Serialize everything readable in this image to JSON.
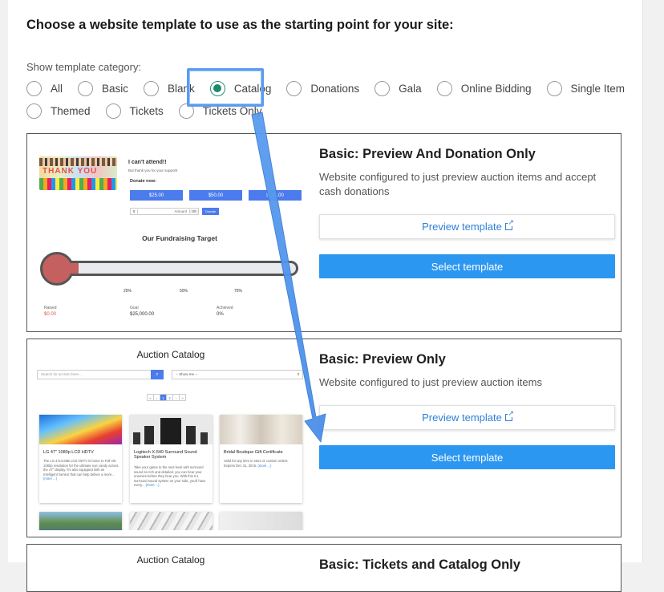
{
  "heading": "Choose a website template to use as the starting point for your site:",
  "category_label": "Show template category:",
  "categories_row1": [
    {
      "label": "All",
      "checked": false
    },
    {
      "label": "Basic",
      "checked": false
    },
    {
      "label": "Blank",
      "checked": false
    },
    {
      "label": "Catalog",
      "checked": true
    },
    {
      "label": "Donations",
      "checked": false
    },
    {
      "label": "Gala",
      "checked": false
    },
    {
      "label": "Online Bidding",
      "checked": false
    },
    {
      "label": "Single Item",
      "checked": false
    }
  ],
  "categories_row2": [
    {
      "label": "Themed",
      "checked": false
    },
    {
      "label": "Tickets",
      "checked": false
    },
    {
      "label": "Tickets Only",
      "checked": false
    }
  ],
  "colors": {
    "accent": "#2c97f0",
    "selected_radio": "#1c8a6d",
    "highlight": "#5a9bf0"
  },
  "cards": [
    {
      "title": "Basic: Preview And Donation Only",
      "description": "Website configured to just preview auction items and accept cash donations",
      "preview_label": "Preview template",
      "select_label": "Select template",
      "thumbnail": {
        "banner": "THANK YOU",
        "cant_attend": "I can't attend!!",
        "thanks": "But thank you for your support!",
        "donate_now": "Donate now:",
        "amounts": [
          "$25.00",
          "$50.00",
          "$100.00"
        ],
        "amount_prefix": "$",
        "amount_placeholder": "Amount",
        "amount_suffix": "00",
        "donate_button": "Donate",
        "target_title": "Our Fundraising Target",
        "ticks": [
          "25%",
          "50%",
          "75%"
        ],
        "stats": [
          {
            "label": "Raised",
            "value": "$0.00"
          },
          {
            "label": "Goal",
            "value": "$25,000.00"
          },
          {
            "label": "Achieved",
            "value": "0%"
          }
        ]
      }
    },
    {
      "title": "Basic: Preview Only",
      "description": "Website configured to just preview auction items",
      "preview_label": "Preview template",
      "select_label": "Select template",
      "thumbnail": {
        "title": "Auction Catalog",
        "search_placeholder": "Search for an item here...",
        "show_me": "-- Show me --",
        "pages": [
          "«",
          "‹",
          "1",
          "2",
          "›",
          "»"
        ],
        "items": [
          {
            "title": "LG 47\" 1080p LCD HDTV",
            "text": "The LG 47LG45B LCD HDTV is home to Full HD 1080p resolution for the ultimate eye candy across the 47\" display. It's also equipped with an Intelligent Sensor that can help deliver a more...",
            "more": "(more ...)"
          },
          {
            "title": "Logitech X-540 Surround Sound Speaker System",
            "text": "Take your game to the next level with surround sound so rich and detailed, you can hear your enemies before they hear you. With this 5.1 surround sound system on your side, you'll have every...",
            "more": "(more ...)"
          },
          {
            "title": "Bridal Boutique Gift Certificate",
            "text": "Valid for any item in store or custom orders. Expires Dec 31, 2015.",
            "more": "(more ...)"
          }
        ]
      }
    },
    {
      "title": "Basic: Tickets and Catalog Only",
      "thumbnail": {
        "title": "Auction Catalog"
      }
    }
  ]
}
